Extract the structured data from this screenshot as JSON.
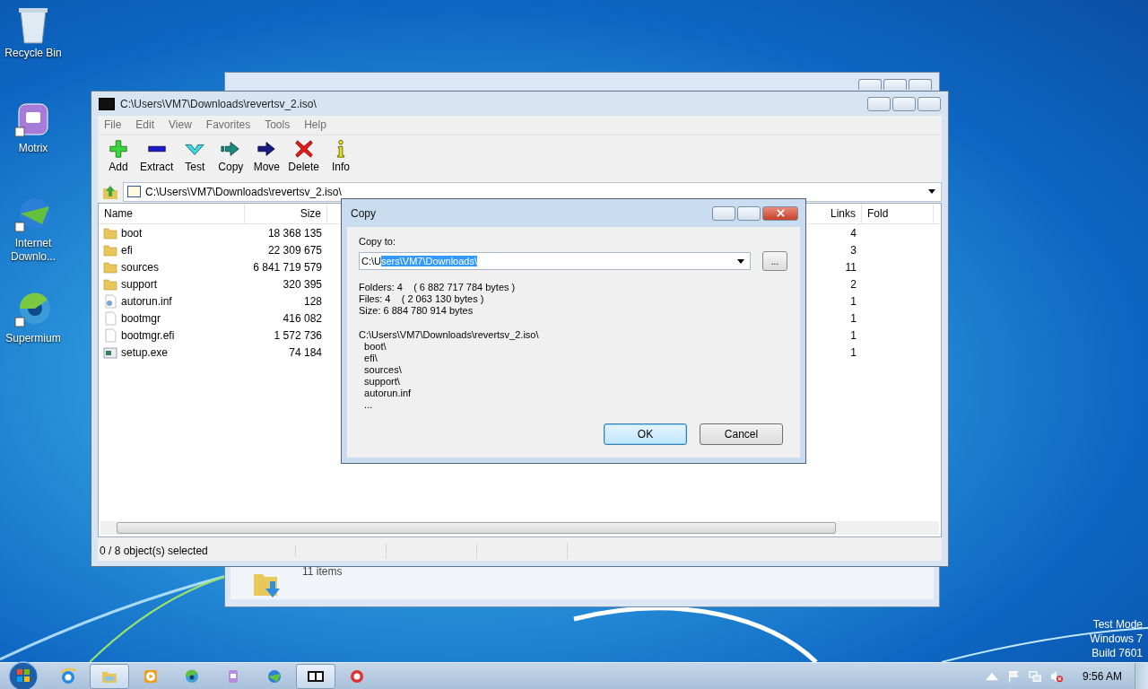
{
  "desktop_icons": [
    {
      "label": "Recycle Bin",
      "kind": "recycle"
    },
    {
      "label": "Motrix",
      "kind": "motrix"
    },
    {
      "label": "Internet Downlo...",
      "kind": "idm"
    },
    {
      "label": "Supermium",
      "kind": "supermium"
    }
  ],
  "background_window": {
    "status": "11 items"
  },
  "main_window": {
    "title": "C:\\Users\\VM7\\Downloads\\revertsv_2.iso\\",
    "menu": [
      "File",
      "Edit",
      "View",
      "Favorites",
      "Tools",
      "Help"
    ],
    "toolbar": [
      {
        "label": "Add",
        "kind": "add"
      },
      {
        "label": "Extract",
        "kind": "extract"
      },
      {
        "label": "Test",
        "kind": "test"
      },
      {
        "label": "Copy",
        "kind": "copy"
      },
      {
        "label": "Move",
        "kind": "move"
      },
      {
        "label": "Delete",
        "kind": "delete"
      },
      {
        "label": "Info",
        "kind": "info"
      }
    ],
    "address": "C:\\Users\\VM7\\Downloads\\revertsv_2.iso\\",
    "columns": {
      "name": "Name",
      "size": "Size",
      "links": "Links",
      "column_5": "Fold"
    },
    "rows": [
      {
        "name": "boot",
        "size": "18 368 135",
        "links": "4",
        "kind": "folder"
      },
      {
        "name": "efi",
        "size": "22 309 675",
        "links": "3",
        "kind": "folder"
      },
      {
        "name": "sources",
        "size": "6 841 719 579",
        "links": "11",
        "kind": "folder"
      },
      {
        "name": "support",
        "size": "320 395",
        "links": "2",
        "kind": "folder"
      },
      {
        "name": "autorun.inf",
        "size": "128",
        "links": "1",
        "kind": "settings"
      },
      {
        "name": "bootmgr",
        "size": "416 082",
        "links": "1",
        "kind": "file"
      },
      {
        "name": "bootmgr.efi",
        "size": "1 572 736",
        "links": "1",
        "kind": "file"
      },
      {
        "name": "setup.exe",
        "size": "74 184",
        "links": "1",
        "kind": "program"
      }
    ],
    "status_bar": "0 / 8 object(s) selected"
  },
  "dialog": {
    "title": "Copy",
    "label": "Copy to:",
    "path_unselected": "C:\\U",
    "path_selected": "sers\\VM7\\Downloads\\",
    "browse": "...",
    "summary": [
      "Folders: 4    ( 6 882 717 784 bytes )",
      "Files: 4    ( 2 063 130 bytes )",
      "Size: 6 884 780 914 bytes"
    ],
    "listing": [
      "C:\\Users\\VM7\\Downloads\\revertsv_2.iso\\",
      "  boot\\",
      "  efi\\",
      "  sources\\",
      "  support\\",
      "  autorun.inf",
      "  ..."
    ],
    "buttons": [
      {
        "label": "OK",
        "default": true
      },
      {
        "label": "Cancel",
        "default": false
      }
    ]
  },
  "taskbar": {
    "items": [
      {
        "kind": "ie",
        "active": false
      },
      {
        "kind": "explorer",
        "active": true
      },
      {
        "kind": "media",
        "active": false
      },
      {
        "kind": "globe",
        "active": false
      },
      {
        "kind": "motrix",
        "active": false
      },
      {
        "kind": "idm",
        "active": false
      },
      {
        "kind": "sevenzip",
        "active": true
      },
      {
        "kind": "red",
        "active": false
      }
    ],
    "clock": "9:56 AM"
  },
  "watermark": [
    "Test Mode",
    "Windows 7",
    "Build 7601"
  ]
}
